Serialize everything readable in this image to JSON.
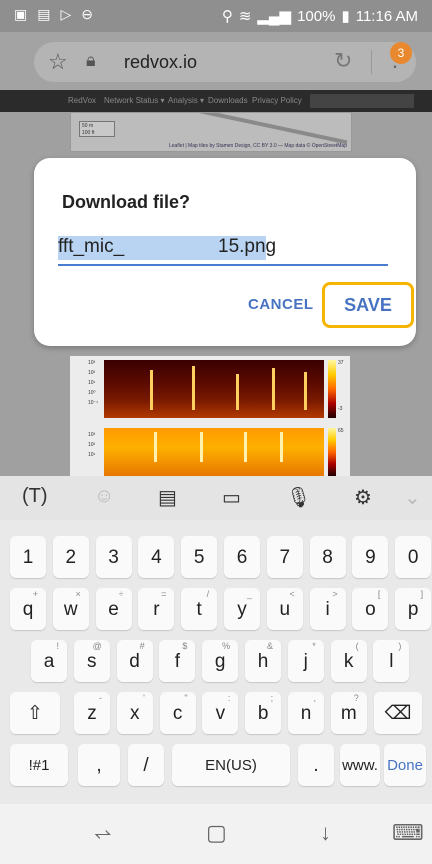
{
  "status_bar": {
    "left_icons": [
      "gallery-icon",
      "image-icon",
      "play-icon",
      "minus-circle-icon"
    ],
    "battery": "100%",
    "time": "11:16 AM"
  },
  "browser": {
    "url": "redvox.io",
    "tab_count": "3"
  },
  "webpage": {
    "nav_items": [
      "RedVox",
      "Network Status ▾",
      "Analysis ▾",
      "Downloads",
      "Privacy Policy"
    ],
    "map_attribution": "Leaflet | Map tiles by Stamen Design, CC BY 3.0 — Map data © OpenStreetMap",
    "map_scale": [
      "50 m",
      "100 ft"
    ],
    "spec1_yticks": [
      "10³",
      "10²",
      "10¹",
      "10⁰",
      "10⁻¹"
    ],
    "spec2_yticks": [
      "10³",
      "10²",
      "10¹"
    ],
    "spec1_cbar": [
      "37",
      "-3"
    ],
    "spec2_cbar": [
      "65"
    ]
  },
  "dialog": {
    "title": "Download file?",
    "filename_part1": "fft_mic_",
    "filename_part2": "15",
    "filename_ext": ".png",
    "cancel_label": "CANCEL",
    "save_label": "SAVE"
  },
  "keyboard": {
    "toolbar_icons": [
      "text-cursor-icon",
      "emoji-icon",
      "clipboard-icon",
      "sticker-icon",
      "microphone-icon",
      "gear-icon",
      "chevron-down-icon"
    ],
    "numbers": [
      "1",
      "2",
      "3",
      "4",
      "5",
      "6",
      "7",
      "8",
      "9",
      "0"
    ],
    "row1": [
      [
        "q",
        "+"
      ],
      [
        "w",
        "×"
      ],
      [
        "e",
        "÷"
      ],
      [
        "r",
        "="
      ],
      [
        "t",
        "/"
      ],
      [
        "y",
        "_"
      ],
      [
        "u",
        "<"
      ],
      [
        "i",
        ">"
      ],
      [
        "o",
        "["
      ],
      [
        "p",
        "]"
      ]
    ],
    "row2": [
      [
        "a",
        "!"
      ],
      [
        "s",
        "@"
      ],
      [
        "d",
        "#"
      ],
      [
        "f",
        "$"
      ],
      [
        "g",
        "%"
      ],
      [
        "h",
        "&"
      ],
      [
        "j",
        "*"
      ],
      [
        "k",
        "("
      ],
      [
        "l",
        ")"
      ]
    ],
    "row3": [
      [
        "z",
        "-"
      ],
      [
        "x",
        "'"
      ],
      [
        "c",
        "\""
      ],
      [
        "v",
        ":"
      ],
      [
        "b",
        ";"
      ],
      [
        "n",
        ","
      ],
      [
        "m",
        "?"
      ]
    ],
    "sym_label": "!#1",
    "comma_label": ",",
    "slash_label": "/",
    "space_label": "EN(US)",
    "period_label": ".",
    "www_label": "www.",
    "done_label": "Done",
    "shift_icon": "⇧",
    "backspace_icon": "⌫"
  }
}
